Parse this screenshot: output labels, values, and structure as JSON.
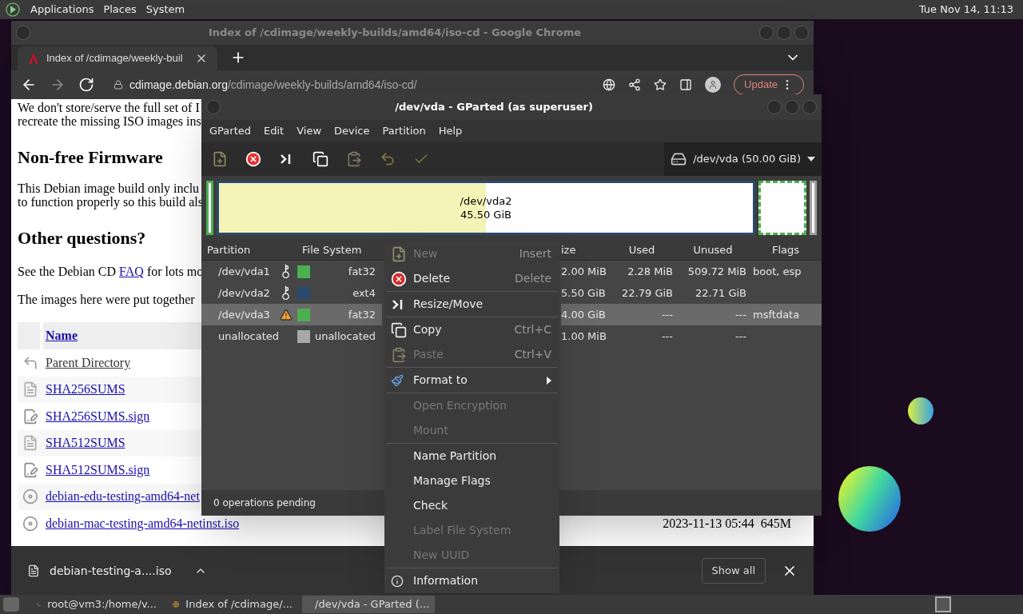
{
  "top_panel": {
    "menus": [
      "Applications",
      "Places",
      "System"
    ],
    "clock": "Tue Nov 14, 11:13"
  },
  "browser": {
    "title": "Index of /cdimage/weekly-builds/amd64/iso-cd - Google Chrome",
    "tab": "Index of /cdimage/weekly-buil",
    "address": {
      "host": "cdimage.debian.org",
      "path": "/cdimage/weekly-builds/amd64/iso-cd/"
    },
    "update_button": "Update",
    "page": {
      "blocks": [
        {
          "kind": "p",
          "lines": [
            "We don't store/serve the full set of I",
            "recreate the missing ISO images ins"
          ]
        },
        {
          "kind": "h2",
          "text": "Non-free Firmware"
        },
        {
          "kind": "p",
          "lines": [
            "This Debian image build only inclu",
            "to function properly so this build als"
          ]
        },
        {
          "kind": "h2",
          "text": "Other questions?"
        },
        {
          "kind": "link_p",
          "before": "See the Debian CD ",
          "link": "FAQ",
          "after": " for lots mo"
        },
        {
          "kind": "p",
          "lines": [
            "The images here were put together"
          ]
        }
      ],
      "listing": {
        "header": "Name",
        "rows": [
          {
            "kind": "parent",
            "name": "Parent Directory"
          },
          {
            "kind": "text",
            "name": "SHA256SUMS"
          },
          {
            "kind": "sign",
            "name": "SHA256SUMS.sign"
          },
          {
            "kind": "text",
            "name": "SHA512SUMS"
          },
          {
            "kind": "sign",
            "name": "SHA512SUMS.sign"
          },
          {
            "kind": "image",
            "name": "debian-edu-testing-amd64-net"
          },
          {
            "kind": "image",
            "name": "debian-mac-testing-amd64-netinst.iso",
            "date": "2023-11-13 05:44",
            "size": "645M"
          }
        ]
      }
    },
    "download_bar": {
      "file": "debian-testing-a....iso",
      "show_all": "Show all"
    }
  },
  "gparted": {
    "title": "/dev/vda - GParted (as superuser)",
    "menus": [
      "GParted",
      "Edit",
      "View",
      "Device",
      "Partition",
      "Help"
    ],
    "toolbar": [
      {
        "kind": "new",
        "disabled": true
      },
      {
        "kind": "delete",
        "disabled": false
      },
      {
        "kind": "resize",
        "disabled": false
      },
      {
        "kind": "copy",
        "disabled": false
      },
      {
        "kind": "paste",
        "disabled": true
      },
      {
        "kind": "undo",
        "disabled": true
      },
      {
        "kind": "apply",
        "disabled": true
      }
    ],
    "device": "/dev/vda (50.00 GiB)",
    "disk_map": [
      {
        "kind": "thin",
        "color": "#4caf50",
        "selected": false
      },
      {
        "kind": "main",
        "color": "#2a4a6b",
        "selected": false,
        "label": "/dev/vda2",
        "size": "45.50 GiB",
        "level": 0.5
      },
      {
        "kind": "box",
        "color": "#4caf50",
        "selected": true
      },
      {
        "kind": "thin",
        "color": "#a0a0a0",
        "selected": false
      }
    ],
    "columns": {
      "partition": "Partition",
      "file_system": "File System",
      "column_3": "ize",
      "used": "Used",
      "unused": "Unused",
      "flags": "Flags"
    },
    "rows": [
      {
        "partition": "/dev/vda1",
        "mounted": true,
        "warning": false,
        "color": "#4caf50",
        "fs": "fat32",
        "size": "2.00 MiB",
        "used": "2.28 MiB",
        "unused": "509.72 MiB",
        "flags": "boot, esp",
        "selected": false
      },
      {
        "partition": "/dev/vda2",
        "mounted": true,
        "warning": false,
        "color": "#2a4a6b",
        "fs": "ext4",
        "size": "5.50 GiB",
        "used": "22.79 GiB",
        "unused": "22.71 GiB",
        "selected": false
      },
      {
        "partition": "/dev/vda3",
        "mounted": false,
        "warning": true,
        "color": "#4caf50",
        "fs": "fat32",
        "size": "4.00 GiB",
        "used": "---",
        "unused": "---",
        "flags": "msftdata",
        "selected": true
      },
      {
        "partition": "unallocated",
        "mounted": false,
        "warning": false,
        "color": "#a8a8a8",
        "fs": "unallocated",
        "size": "1.00 MiB",
        "used": "---",
        "unused": "---",
        "selected": false
      }
    ],
    "status": "0 operations pending"
  },
  "context_menu": [
    {
      "kind": "new",
      "label": "New",
      "shortcut": "Insert",
      "disabled": true
    },
    {
      "kind": "delete",
      "label": "Delete",
      "shortcut": "Delete",
      "disabled": false
    },
    {
      "kind": "separator"
    },
    {
      "kind": "resize",
      "label": "Resize/Move",
      "disabled": false
    },
    {
      "kind": "separator"
    },
    {
      "kind": "copy",
      "label": "Copy",
      "shortcut": "Ctrl+C",
      "disabled": false
    },
    {
      "kind": "paste",
      "label": "Paste",
      "shortcut": "Ctrl+V",
      "disabled": true
    },
    {
      "kind": "separator"
    },
    {
      "kind": "format",
      "label": "Format to",
      "disabled": false
    },
    {
      "kind": "separator"
    },
    {
      "kind": "plain",
      "label": "Open Encryption",
      "disabled": true
    },
    {
      "kind": "plain",
      "label": "Mount",
      "disabled": true
    },
    {
      "kind": "separator"
    },
    {
      "kind": "plain",
      "label": "Name Partition",
      "disabled": false
    },
    {
      "kind": "plain",
      "label": "Manage Flags",
      "disabled": false
    },
    {
      "kind": "plain",
      "label": "Check",
      "disabled": false
    },
    {
      "kind": "plain",
      "label": "Label File System",
      "disabled": true
    },
    {
      "kind": "plain",
      "label": "New UUID",
      "disabled": true
    },
    {
      "kind": "separator"
    },
    {
      "kind": "info",
      "label": "Information",
      "disabled": false
    }
  ],
  "taskbar": [
    {
      "label": "root@vm3:/home/v...",
      "kind": "terminal",
      "selected": false
    },
    {
      "label": "Index of /cdimage/...",
      "kind": "browser",
      "selected": false
    },
    {
      "label": "/dev/vda - GParted (...",
      "kind": "disk",
      "selected": true
    }
  ]
}
